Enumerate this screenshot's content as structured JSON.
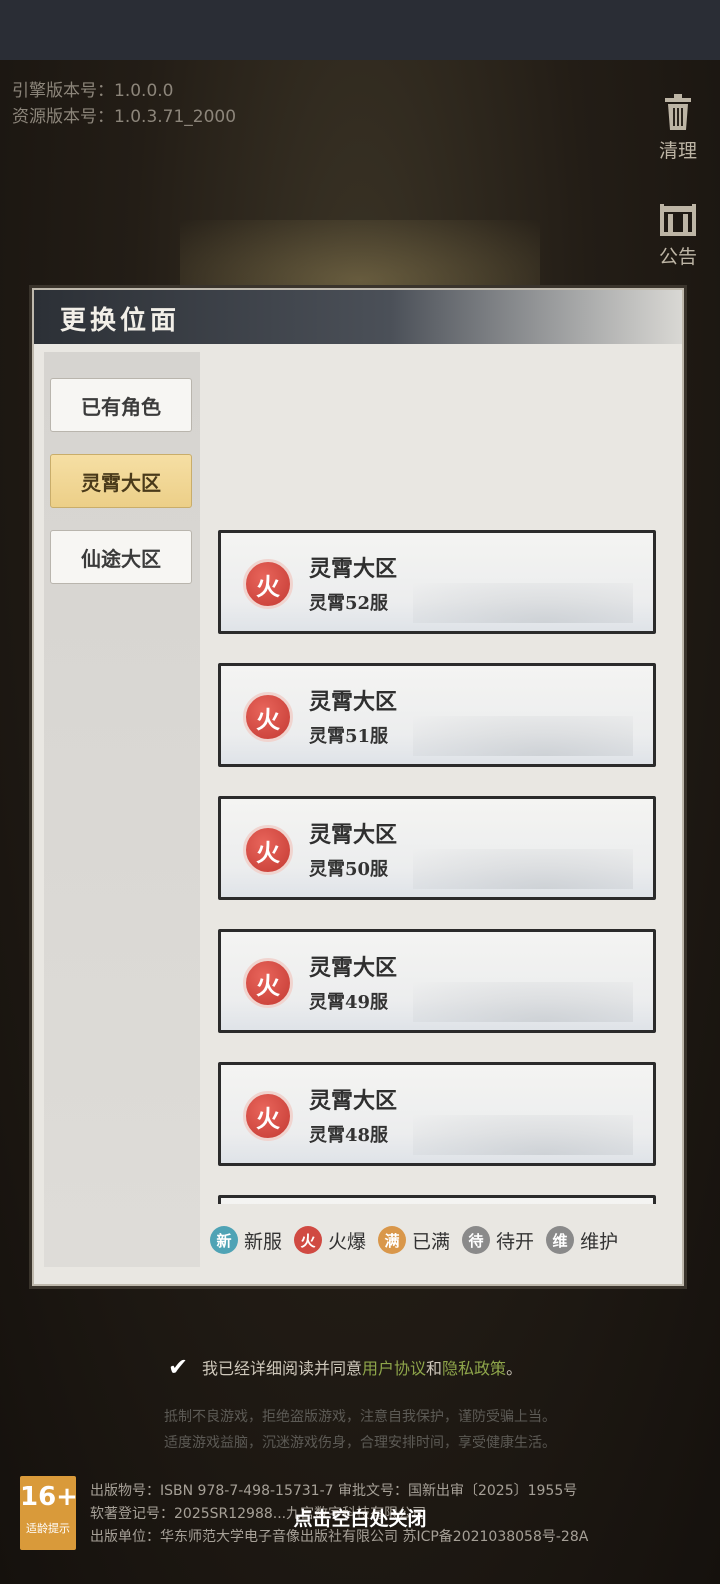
{
  "version": {
    "engine": "引擎版本号：1.0.0.0",
    "resource": "资源版本号：1.0.3.71_2000"
  },
  "side_buttons": {
    "clean": "清理",
    "notice": "公告"
  },
  "dialog": {
    "title": "更换位面",
    "tabs": [
      "已有角色",
      "灵霄大区",
      "仙途大区"
    ],
    "active_tab": "灵霄大区",
    "servers": [
      {
        "region": "灵霄大区",
        "name": "灵霄52服",
        "status": "火"
      },
      {
        "region": "灵霄大区",
        "name": "灵霄51服",
        "status": "火"
      },
      {
        "region": "灵霄大区",
        "name": "灵霄50服",
        "status": "火"
      },
      {
        "region": "灵霄大区",
        "name": "灵霄49服",
        "status": "火"
      },
      {
        "region": "灵霄大区",
        "name": "灵霄48服",
        "status": "火"
      }
    ],
    "legend": [
      {
        "icon": "新",
        "label": "新服",
        "color": "#4fa3b5"
      },
      {
        "icon": "火",
        "label": "火爆",
        "color": "#d04a42"
      },
      {
        "icon": "满",
        "label": "已满",
        "color": "#d9974a"
      },
      {
        "icon": "待",
        "label": "待开",
        "color": "#8a8a8a"
      },
      {
        "icon": "维",
        "label": "维护",
        "color": "#8a8a8a"
      }
    ]
  },
  "agreement": {
    "prefix": "我已经详细阅读并同意",
    "user_agreement": "用户协议",
    "and": "和",
    "privacy": "隐私政策",
    "suffix": "。"
  },
  "notice_lines": [
    "抵制不良游戏，拒绝盗版游戏，注意自我保护，谨防受骗上当。",
    "适度游戏益脑，沉迷游戏伤身，合理安排时间，享受健康生活。"
  ],
  "rating": {
    "age": "16+",
    "label": "适龄提示"
  },
  "publication": [
    "出版物号：ISBN 978-7-498-15731-7  审批文号：国新出审〔2025〕1955号",
    "软著登记号：2025SR12988...九宫数字科技有限公司",
    "出版单位：华东师范大学电子音像出版社有限公司  苏ICP备2021038058号-28A"
  ],
  "close_hint": "点击空白处关闭"
}
